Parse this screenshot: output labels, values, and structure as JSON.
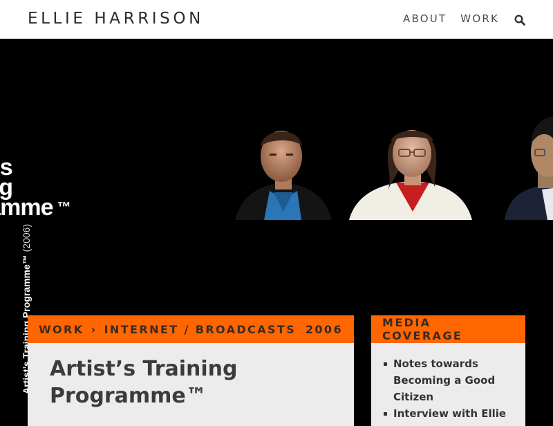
{
  "header": {
    "site_title": "ELLIE HARRISON",
    "nav": [
      {
        "label": "ABOUT"
      },
      {
        "label": "WORK"
      }
    ]
  },
  "hero": {
    "logo_lines": [
      "rt’s",
      "ing",
      "ramme"
    ],
    "logo_tm": "™",
    "vertical_caption": "Artist’s Training Programme™",
    "vertical_year": "(2006)"
  },
  "main_panel": {
    "breadcrumb": [
      "WORK",
      "INTERNET / BROADCASTS"
    ],
    "breadcrumb_separator": "›",
    "year": "2006",
    "title": "Artist’s Training Programme™"
  },
  "side_panel": {
    "heading": "MEDIA COVERAGE",
    "items": [
      "Notes towards Becoming a Good Citizen",
      "Interview with Ellie"
    ]
  },
  "colors": {
    "accent": "#ff6600",
    "panel_bg": "#ececec",
    "hero_bg": "#000000"
  }
}
